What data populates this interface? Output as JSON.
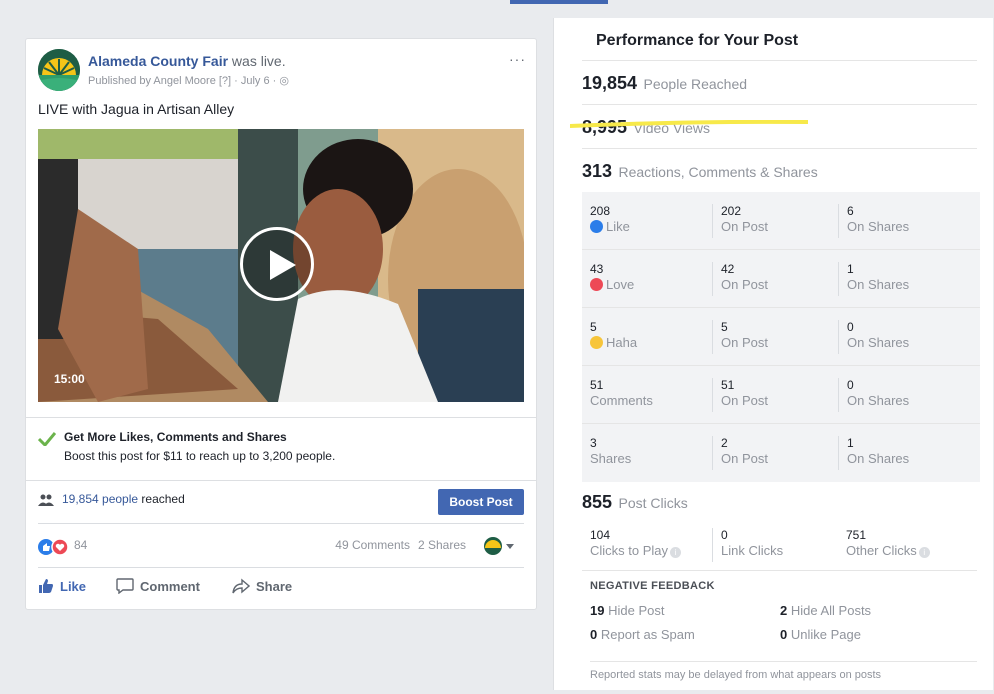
{
  "post": {
    "page_name": "Alameda County Fair",
    "was_live": "was live.",
    "published_by": "Published by Angel Moore [?] · July 6 ·",
    "more": "···",
    "text": "LIVE with Jagua in Artisan Alley",
    "video_duration": "15:00",
    "boost_title": "Get More Likes, Comments and Shares",
    "boost_sub": "Boost this post for $11 to reach up to 3,200 people.",
    "reach_num": "19,854 people",
    "reach_suffix": " reached",
    "boost_button": "Boost Post",
    "reaction_count": "84",
    "comments": "49 Comments",
    "shares": "2 Shares",
    "actions": {
      "like": "Like",
      "comment": "Comment",
      "share": "Share"
    }
  },
  "performance": {
    "title": "Performance for Your Post",
    "people_reached": {
      "value": "19,854",
      "label": "People Reached"
    },
    "video_views": {
      "value": "8,995",
      "label": "Video Views"
    },
    "engagement": {
      "value": "313",
      "label": "Reactions, Comments & Shares"
    },
    "rows": [
      {
        "total": "208",
        "name": "Like",
        "on_post": "202",
        "on_post_label": "On Post",
        "on_shares": "6",
        "on_shares_label": "On Shares"
      },
      {
        "total": "43",
        "name": "Love",
        "on_post": "42",
        "on_post_label": "On Post",
        "on_shares": "1",
        "on_shares_label": "On Shares"
      },
      {
        "total": "5",
        "name": "Haha",
        "on_post": "5",
        "on_post_label": "On Post",
        "on_shares": "0",
        "on_shares_label": "On Shares"
      },
      {
        "total": "51",
        "name": "Comments",
        "on_post": "51",
        "on_post_label": "On Post",
        "on_shares": "0",
        "on_shares_label": "On Shares"
      },
      {
        "total": "3",
        "name": "Shares",
        "on_post": "2",
        "on_post_label": "On Post",
        "on_shares": "1",
        "on_shares_label": "On Shares"
      }
    ],
    "post_clicks": {
      "value": "855",
      "label": "Post Clicks"
    },
    "clicks": [
      {
        "value": "104",
        "label": "Clicks to Play"
      },
      {
        "value": "0",
        "label": "Link Clicks"
      },
      {
        "value": "751",
        "label": "Other Clicks"
      }
    ],
    "negative_title": "NEGATIVE FEEDBACK",
    "negative": [
      {
        "value": "19",
        "label": "Hide Post"
      },
      {
        "value": "2",
        "label": "Hide All Posts"
      },
      {
        "value": "0",
        "label": "Report as Spam"
      },
      {
        "value": "0",
        "label": "Unlike Page"
      }
    ],
    "footer": "Reported stats may be delayed from what appears on posts"
  },
  "colors": {
    "brand": "#4267b2",
    "link": "#365899",
    "highlight": "#f7e94a",
    "muted": "#90949c"
  }
}
